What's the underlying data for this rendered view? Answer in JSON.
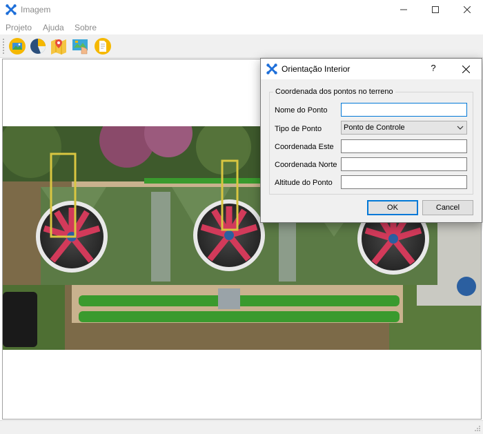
{
  "window": {
    "title": "Imagem"
  },
  "menu": {
    "items": [
      "Projeto",
      "Ajuda",
      "Sobre"
    ]
  },
  "toolbar": {
    "buttons": [
      {
        "icon": "image-icon",
        "color": "#f5b800"
      },
      {
        "icon": "pie-chart-icon",
        "color": "#2c4f7c"
      },
      {
        "icon": "map-pin-icon",
        "color": "#e74c3c"
      },
      {
        "icon": "map-hand-icon",
        "color": "#3aa7d8"
      },
      {
        "icon": "document-icon",
        "color": "#f5b800"
      }
    ]
  },
  "dialog": {
    "title": "Orientação Interior",
    "help_label": "?",
    "group_label": "Coordenada dos pontos no terreno",
    "fields": {
      "point_name": {
        "label": "Nome do Ponto",
        "value": ""
      },
      "point_type": {
        "label": "Tipo de Ponto",
        "value": "Ponto de Controle"
      },
      "east": {
        "label": "Coordenada Este",
        "value": ""
      },
      "north": {
        "label": "Coordenada Norte",
        "value": ""
      },
      "altitude": {
        "label": "Altitude do Ponto",
        "value": ""
      }
    },
    "ok_label": "OK",
    "cancel_label": "Cancel"
  },
  "colors": {
    "accent": "#0078d7",
    "app_icon": "#1e6fd9"
  }
}
